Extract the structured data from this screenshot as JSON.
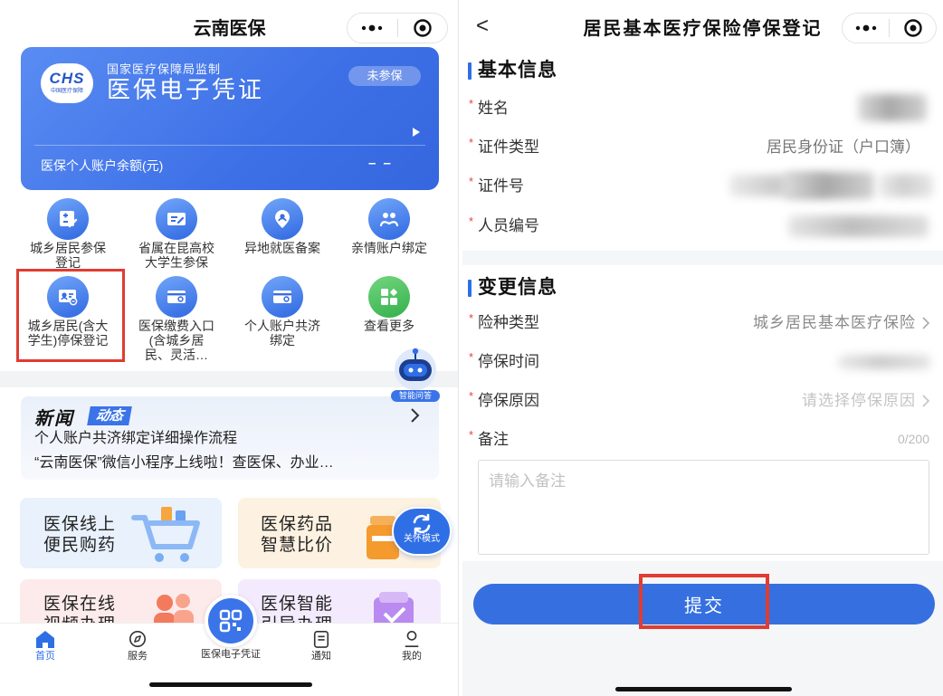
{
  "colors": {
    "accent": "#3670e0",
    "card_blue": "#3d70e6",
    "highlight_red": "#e03c31",
    "required_red": "#e8453c",
    "more_green": "#33b04a"
  },
  "left": {
    "header": {
      "title": "云南医保",
      "menu_icon": "more-dots-icon",
      "target_icon": "target-icon"
    },
    "card": {
      "logo_text": "CHS",
      "logo_subtext": "中国医疗保障",
      "issuer": "国家医疗保障局监制",
      "name": "医保电子凭证",
      "badge": "未参保",
      "balance_label": "医保个人账户余额(元)",
      "balance_value": "– –",
      "arrow_icon": "play-arrow-icon"
    },
    "grid": [
      {
        "label": "城乡居民参保\n登记",
        "icon": "insurance-register-icon"
      },
      {
        "label": "省属在昆高校\n大学生参保",
        "icon": "student-insurance-icon"
      },
      {
        "label": "异地就医备案",
        "icon": "remote-medical-icon"
      },
      {
        "label": "亲情账户绑定",
        "icon": "family-binding-icon"
      },
      {
        "label": "城乡居民(含大\n学生)停保登记",
        "icon": "stop-insurance-icon"
      },
      {
        "label": "医保缴费入口\n(含城乡居\n民、灵活…",
        "icon": "payment-wallet-icon"
      },
      {
        "label": "个人账户共济\n绑定",
        "icon": "account-share-icon"
      },
      {
        "label": "查看更多",
        "icon": "more-services-icon"
      }
    ],
    "assistant": {
      "label": "智能问答",
      "icon": "robot-icon"
    },
    "news": {
      "title": "新闻",
      "tag": "动态",
      "items": [
        "个人账户共济绑定详细操作流程",
        "“云南医保”微信小程序上线啦！查医保、办业…"
      ]
    },
    "services": [
      {
        "label": "医保线上\n便民购药",
        "icon": "shopping-cart-icon"
      },
      {
        "label": "医保药品\n智慧比价",
        "icon": "medicine-bottle-icon"
      },
      {
        "label": "医保在线\n视频办理",
        "icon": "video-service-icon"
      },
      {
        "label": "医保智能\n引导办理",
        "icon": "guide-box-icon"
      }
    ],
    "care_mode": {
      "label": "关怀模式",
      "icon": "refresh-icon"
    },
    "tabbar": {
      "items": [
        {
          "label": "首页",
          "icon": "home-icon"
        },
        {
          "label": "服务",
          "icon": "compass-icon"
        },
        {
          "label": "医保电子凭证",
          "icon": "qr-code-icon"
        },
        {
          "label": "通知",
          "icon": "notice-icon"
        },
        {
          "label": "我的",
          "icon": "user-icon"
        }
      ]
    }
  },
  "right": {
    "header": {
      "back": "<",
      "title": "居民基本医疗保险停保登记"
    },
    "required_mark": "*",
    "basic": {
      "title": "基本信息",
      "fields": [
        {
          "label": "姓名"
        },
        {
          "label": "证件类型",
          "value": "居民身份证（户口簿）"
        },
        {
          "label": "证件号"
        },
        {
          "label": "人员编号"
        }
      ]
    },
    "change": {
      "title": "变更信息",
      "fields": [
        {
          "label": "险种类型",
          "value": "城乡居民基本医疗保险"
        },
        {
          "label": "停保时间"
        },
        {
          "label": "停保原因",
          "placeholder": "请选择停保原因"
        },
        {
          "label": "备注",
          "counter": "0/200"
        }
      ]
    },
    "remark": {
      "placeholder": "请输入备注"
    },
    "submit": "提交"
  }
}
